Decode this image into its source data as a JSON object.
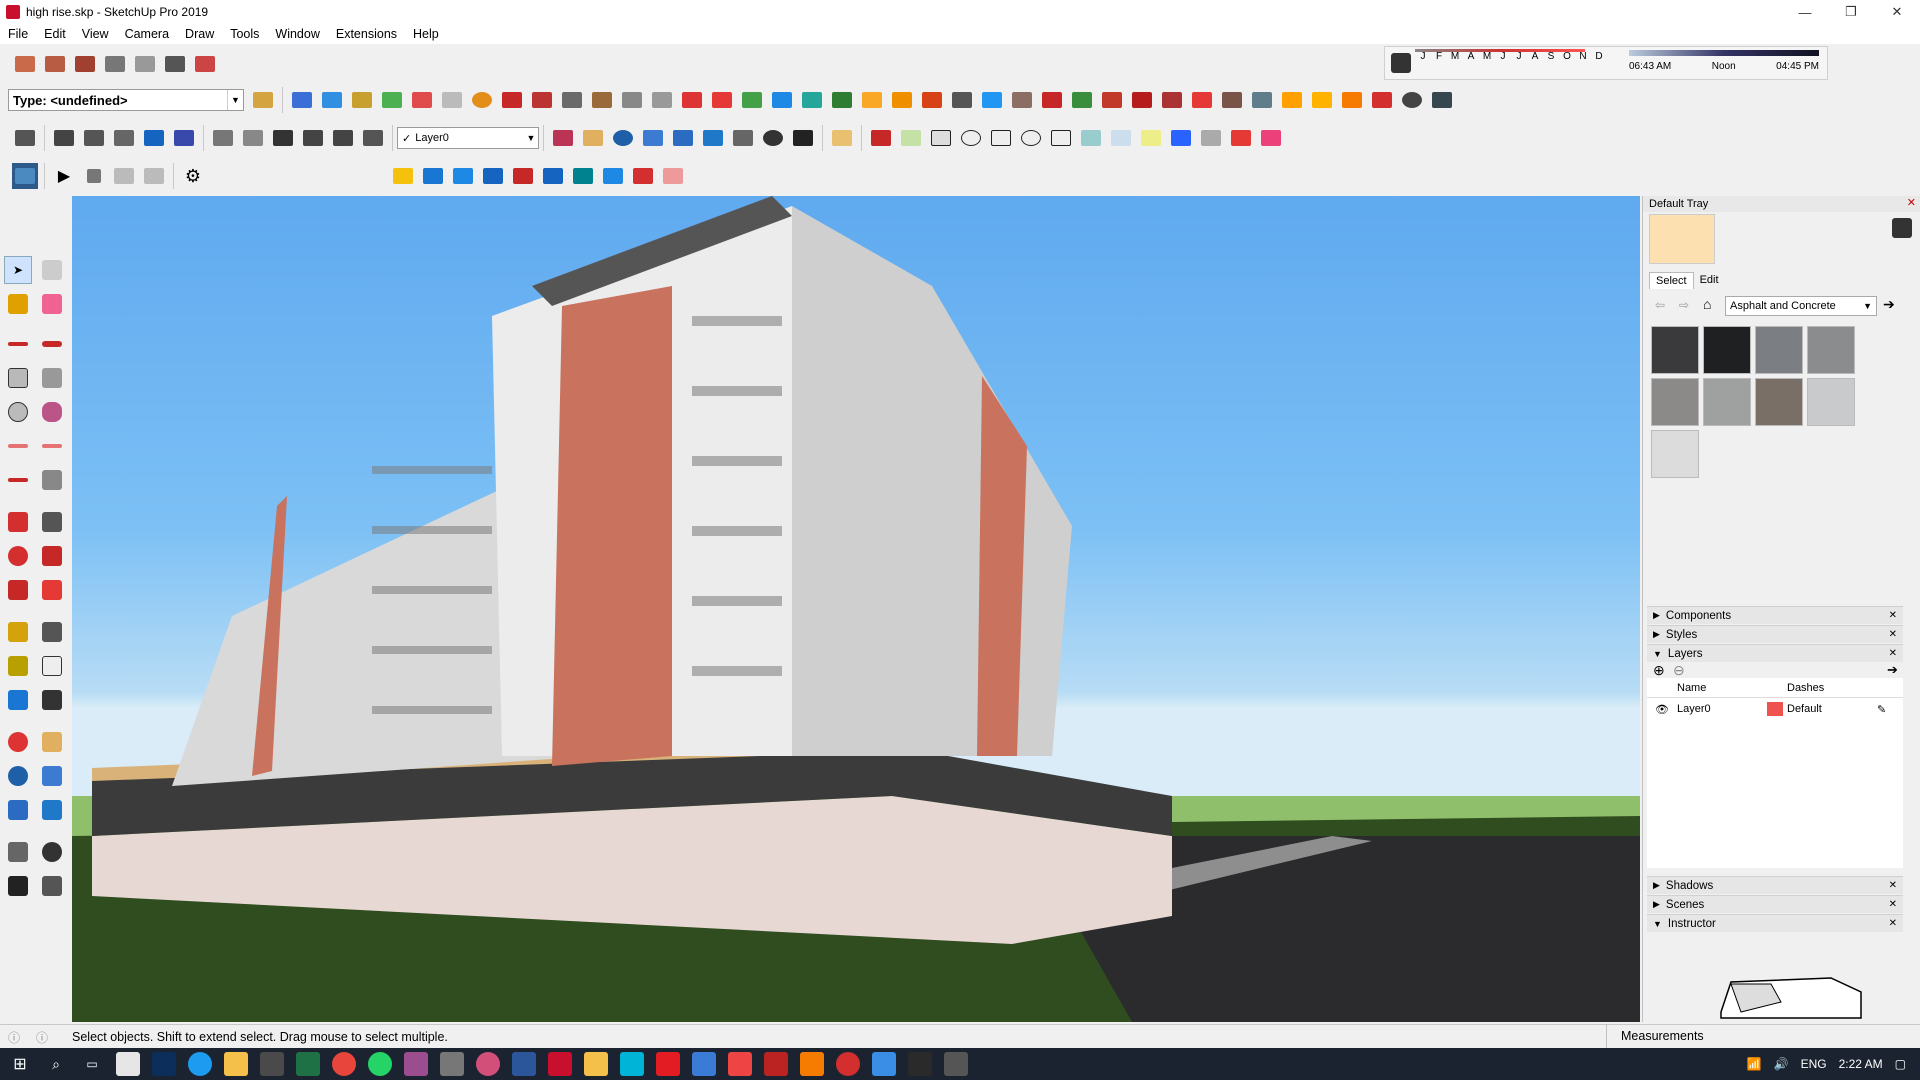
{
  "window": {
    "title": "high rise.skp - SketchUp Pro 2019",
    "minimize": "—",
    "maximize": "❐",
    "close": "✕"
  },
  "menu": [
    "File",
    "Edit",
    "View",
    "Camera",
    "Draw",
    "Tools",
    "Window",
    "Extensions",
    "Help"
  ],
  "toolbar": {
    "type_value": "Type: <undefined>",
    "layer_value": "Layer0"
  },
  "shadow": {
    "months": [
      "J",
      "F",
      "M",
      "A",
      "M",
      "J",
      "J",
      "A",
      "S",
      "O",
      "N",
      "D"
    ],
    "time_start": "06:43 AM",
    "time_mid": "Noon",
    "time_end": "04:45 PM"
  },
  "tray": {
    "title": "Default Tray",
    "tabs": [
      "Select",
      "Edit"
    ],
    "material_collection": "Asphalt and Concrete",
    "swatches": [
      "#3a3a3c",
      "#1f2022",
      "#7b7f84",
      "#8a8c8e",
      "#8c8a89",
      "#9ea19f",
      "#7a6f66",
      "#c9cacc",
      "#dcdcdc"
    ],
    "sections": {
      "components": "Components",
      "styles": "Styles",
      "layers": "Layers",
      "shadows": "Shadows",
      "scenes": "Scenes",
      "instructor": "Instructor"
    },
    "layers_table": {
      "col_name": "Name",
      "col_dashes": "Dashes",
      "row_name": "Layer0",
      "row_dashes": "Default",
      "row_color": "#ef5350"
    }
  },
  "status": {
    "message": "Select objects. Shift to extend select. Drag mouse to select multiple.",
    "measurements_label": "Measurements"
  },
  "taskbar": {
    "language": "ENG",
    "time": "2:22 AM"
  }
}
